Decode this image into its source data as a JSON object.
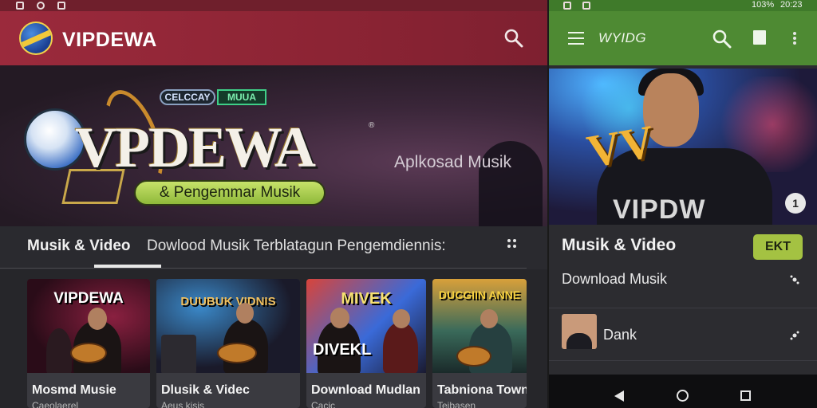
{
  "left_app": {
    "title": "VIPDEWA",
    "hero": {
      "pill_1": "CELCCAY",
      "pill_2": "MUUA",
      "brand": "VPDEWA",
      "tm": "®",
      "subtitle": "Aplkosad Musik",
      "cta": "& Pengemmar Musik"
    },
    "tabs": [
      {
        "label": "Musik & Video"
      },
      {
        "label": "Dowlood Musik Terblatagun Pengemdiennis:"
      }
    ],
    "cards": [
      {
        "thumb_title": "VIPDEWA",
        "title": "Mosmd Musie",
        "sub": "Caeolaerel"
      },
      {
        "thumb_title": "DUUBUK VIDNIS",
        "title": "Dlusik & Videc",
        "sub": "Aeus kisis"
      },
      {
        "thumb_title": "MIVEK",
        "thumb_title_2": "DIVEKL",
        "title": "Download Mudlan",
        "sub": "Cacic"
      },
      {
        "thumb_title": "DUCGIIN ANNE",
        "title": "Tabniona Town",
        "sub": "Teibasen"
      }
    ]
  },
  "right_app": {
    "status": {
      "battery": "103%",
      "time": "20:23"
    },
    "title": "WYIDG",
    "hero": {
      "logo": "VV",
      "shirt": "VIPDW",
      "badge": "1"
    },
    "section_title": "Musik & Video",
    "section_button": "EKT",
    "items": [
      {
        "label": "Download Musik"
      },
      {
        "label": "Dank"
      }
    ]
  },
  "colors": {
    "left_appbar": "#9b2a3c",
    "right_appbar": "#4e8a33",
    "accent_green": "#a4c242",
    "background": "#26262a"
  },
  "icons": {
    "left_search": "search-icon",
    "right_search": "search-icon",
    "menu": "hamburger-menu-icon",
    "doc": "document-icon",
    "more": "more-vertical-icon",
    "nav_back": "back-triangle-icon",
    "nav_home": "home-circle-icon",
    "nav_recent": "recent-square-icon"
  }
}
